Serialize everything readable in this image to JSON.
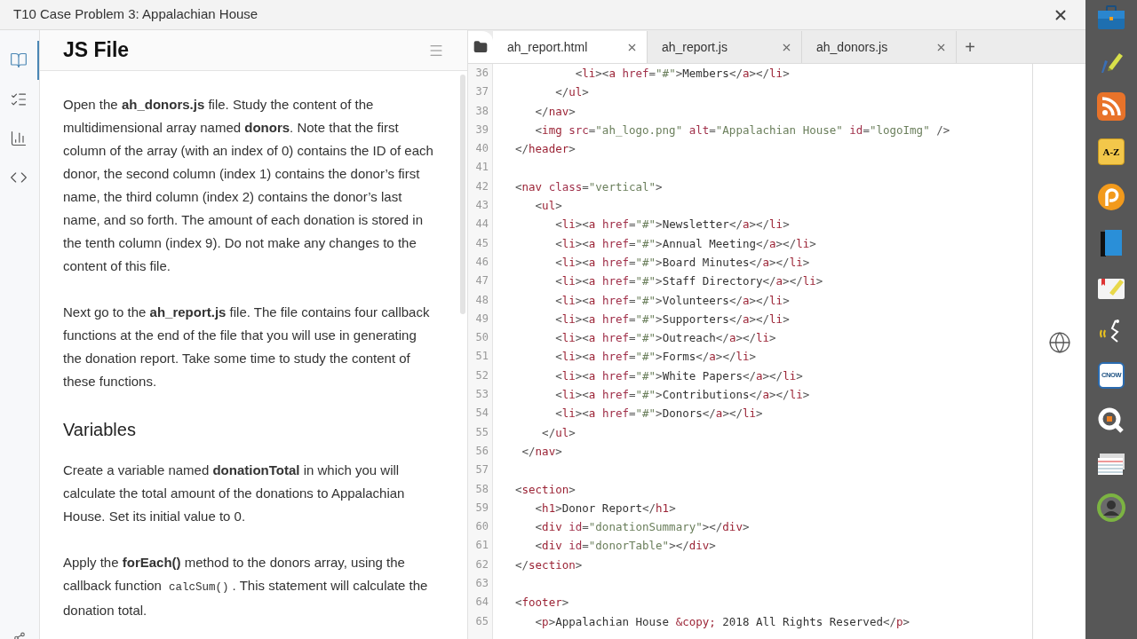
{
  "window": {
    "title": "T10 Case Problem 3: Appalachian House"
  },
  "rail": [
    {
      "kind": "book",
      "selected": true
    },
    {
      "kind": "checklist",
      "selected": false
    },
    {
      "kind": "chart",
      "selected": false
    },
    {
      "kind": "code",
      "selected": false
    }
  ],
  "instructions": {
    "title": "JS File",
    "blocks": [
      {
        "kind": "p",
        "segments": [
          {
            "kind": "text",
            "text": "Open the **ah_donors.js** file. Study the content of the multidimensional array named **donors**. Note that the first column of the array (with an index of 0) contains the ID of each donor, the second column (index 1) contains the donor’s first name, the third column (index 2) contains the donor’s last name, and so forth. The amount of each donation is stored in the tenth column (index 9). Do not make any changes to the content of this file."
          }
        ]
      },
      {
        "kind": "p",
        "segments": [
          {
            "kind": "text",
            "text": "Next go to the **ah_report.js** file. The file contains four callback functions at the end of the file that you will use in generating the donation report. Take some time to study the content of these functions."
          }
        ]
      },
      {
        "kind": "h2",
        "segments": [
          {
            "kind": "text",
            "text": "Variables"
          }
        ]
      },
      {
        "kind": "p",
        "segments": [
          {
            "kind": "text",
            "text": "Create a variable named **donationTotal** in which you will calculate the total amount of the donations to Appalachian House. Set its initial value to 0."
          }
        ]
      },
      {
        "kind": "p",
        "segments": [
          {
            "kind": "text",
            "text": "Apply the **forEach()** method to the donors array, using the callback function "
          },
          {
            "kind": "code",
            "text": "calcSum()"
          },
          {
            "kind": "text",
            "text": ". This statement will calculate the donation total."
          }
        ]
      }
    ]
  },
  "editor": {
    "tabs": [
      {
        "label": "ah_report.html",
        "selected": true
      },
      {
        "label": "ah_report.js",
        "selected": false
      },
      {
        "label": "ah_donors.js",
        "selected": false
      }
    ],
    "add_tab": "+",
    "lines": [
      {
        "number": "36",
        "code": "         <li><a href=\"#\">Members</a></li>"
      },
      {
        "number": "37",
        "code": "      </ul>"
      },
      {
        "number": "38",
        "code": "   </nav>"
      },
      {
        "number": "39",
        "code": "   <img src=\"ah_logo.png\" alt=\"Appalachian House\" id=\"logoImg\" />"
      },
      {
        "number": "40",
        "code": "</header>"
      },
      {
        "number": "41"
      },
      {
        "number": "42",
        "code": "<nav class=\"vertical\">"
      },
      {
        "number": "43",
        "code": "   <ul>"
      },
      {
        "number": "44",
        "code": "      <li><a href=\"#\">Newsletter</a></li>"
      },
      {
        "number": "45",
        "code": "      <li><a href=\"#\">Annual Meeting</a></li>"
      },
      {
        "number": "46",
        "code": "      <li><a href=\"#\">Board Minutes</a></li>"
      },
      {
        "number": "47",
        "code": "      <li><a href=\"#\">Staff Directory</a></li>"
      },
      {
        "number": "48",
        "code": "      <li><a href=\"#\">Volunteers</a></li>"
      },
      {
        "number": "49",
        "code": "      <li><a href=\"#\">Supporters</a></li>"
      },
      {
        "number": "50",
        "code": "      <li><a href=\"#\">Outreach</a></li>"
      },
      {
        "number": "51",
        "code": "      <li><a href=\"#\">Forms</a></li>"
      },
      {
        "number": "52",
        "code": "      <li><a href=\"#\">White Papers</a></li>"
      },
      {
        "number": "53",
        "code": "      <li><a href=\"#\">Contributions</a></li>"
      },
      {
        "number": "54",
        "code": "      <li><a href=\"#\">Donors</a></li>"
      },
      {
        "number": "55",
        "code": "    </ul>"
      },
      {
        "number": "56",
        "code": " </nav>"
      },
      {
        "number": "57"
      },
      {
        "number": "58",
        "code": "<section>"
      },
      {
        "number": "59",
        "code": "   <h1>Donor Report</h1>"
      },
      {
        "number": "60",
        "code": "   <div id=\"donationSummary\"></div>"
      },
      {
        "number": "61",
        "code": "   <div id=\"donorTable\"></div>"
      },
      {
        "number": "62",
        "code": "</section>"
      },
      {
        "number": "63"
      },
      {
        "number": "64",
        "code": "<footer>"
      },
      {
        "number": "65",
        "code": "   <p>Appalachian House &copy; 2018 All Rights Reserved</p>"
      }
    ]
  },
  "apps": [
    {
      "kind": "briefcase"
    },
    {
      "kind": "pen"
    },
    {
      "kind": "rss"
    },
    {
      "kind": "glossary",
      "label": "A-Z"
    },
    {
      "kind": "circle-logo"
    },
    {
      "kind": "book"
    },
    {
      "kind": "notes"
    },
    {
      "kind": "audio"
    },
    {
      "kind": "badge",
      "label": "CNOW"
    },
    {
      "kind": "quiz"
    },
    {
      "kind": "cards"
    },
    {
      "kind": "profile"
    }
  ]
}
